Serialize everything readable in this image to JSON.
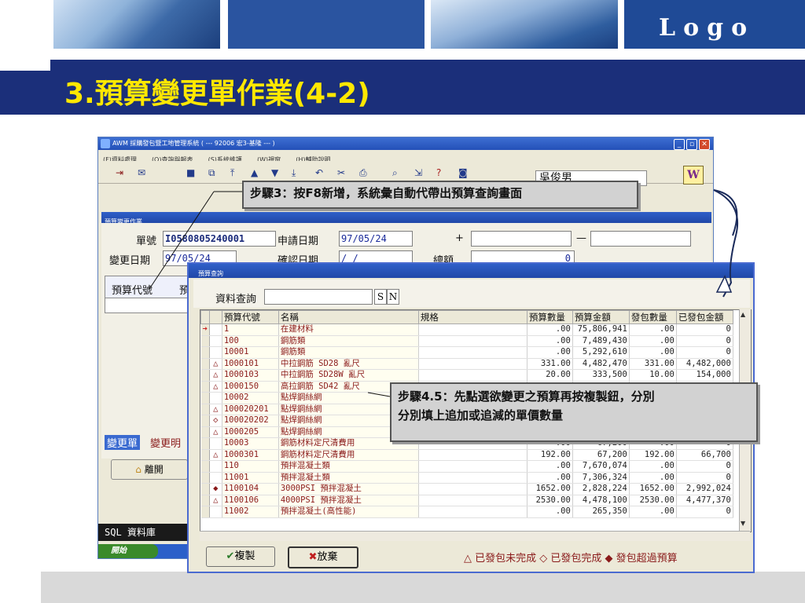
{
  "slide": {
    "logo": "Logo",
    "title": "3.預算變更單作業(4-2)"
  },
  "app": {
    "title": "AWM 採購發包暨工地管理系統 ( --- 92006 宏3-基隆 --- )",
    "menu": [
      "(F)資料處理",
      "(Q)查詢與報表",
      "(S)系統維護",
      "(W)視窗",
      "(H)輔助說明"
    ],
    "user": "吳俊男",
    "w_icon": "W",
    "toolbar_icons": [
      "exit-icon",
      "close-icon",
      "save-icon",
      "copy-icon",
      "first-icon",
      "prev-icon",
      "next-icon",
      "last-icon",
      "undo-icon",
      "cut-icon",
      "print-icon",
      "preview-icon",
      "export-icon",
      "help-icon",
      "camera-icon"
    ]
  },
  "form": {
    "window_title": "預算變更作業",
    "doc_no_label": "單號",
    "doc_no": "I0580805240001",
    "apply_date_label": "申請日期",
    "apply_date": "97/05/24",
    "change_date_label": "變更日期",
    "change_date": "97/05/24",
    "confirm_date_label": "確認日期",
    "confirm_date": "  /  /",
    "total_label": "總額",
    "total_value": "0",
    "plus": "+",
    "minus": "—",
    "grid_header": "預算代號",
    "grid_header2": "預",
    "tab_change": "變更單",
    "tab_detail": "變更明",
    "leave_button": "離開",
    "sql_status": "SQL 資料庫",
    "start_label": "開始"
  },
  "popup": {
    "title": "預算查詢",
    "query_label": "資料查詢",
    "query_value": "",
    "btn_s": "S",
    "btn_n": "N",
    "columns": [
      "預算代號",
      "名稱",
      "規格",
      "預算數量",
      "預算金額",
      "發包數量",
      "已發包金額"
    ],
    "rows": [
      {
        "sel": "➜",
        "mark": "",
        "code": "1",
        "name": "在建材料",
        "spec": "",
        "qty": ".00",
        "amount": "75,806,941",
        "pkg_qty": ".00",
        "pkg_amount": "0"
      },
      {
        "sel": "",
        "mark": "",
        "code": "100",
        "name": "鋼筋類",
        "spec": "",
        "qty": ".00",
        "amount": "7,489,430",
        "pkg_qty": ".00",
        "pkg_amount": "0"
      },
      {
        "sel": "",
        "mark": "",
        "code": "10001",
        "name": "鋼筋類",
        "spec": "",
        "qty": ".00",
        "amount": "5,292,610",
        "pkg_qty": ".00",
        "pkg_amount": "0"
      },
      {
        "sel": "",
        "mark": "△",
        "code": "1000101",
        "name": "中拉鋼筋 SD28 亂尺",
        "spec": "",
        "qty": "331.00",
        "amount": "4,482,470",
        "pkg_qty": "331.00",
        "pkg_amount": "4,482,000"
      },
      {
        "sel": "",
        "mark": "△",
        "code": "1000103",
        "name": "中拉鋼筋 SD28W 亂尺",
        "spec": "",
        "qty": "20.00",
        "amount": "333,500",
        "pkg_qty": "10.00",
        "pkg_amount": "154,000"
      },
      {
        "sel": "",
        "mark": "△",
        "code": "1000150",
        "name": "高拉鋼筋 SD42 亂尺",
        "spec": "",
        "qty": "",
        "amount": "",
        "pkg_qty": "",
        "pkg_amount": ""
      },
      {
        "sel": "",
        "mark": "",
        "code": "10002",
        "name": "點焊鋼絲網",
        "spec": "",
        "qty": "",
        "amount": "",
        "pkg_qty": "",
        "pkg_amount": ""
      },
      {
        "sel": "",
        "mark": "△",
        "code": "100020201",
        "name": "點焊鋼絲網",
        "spec": "",
        "qty": "",
        "amount": "",
        "pkg_qty": "",
        "pkg_amount": ""
      },
      {
        "sel": "",
        "mark": "◇",
        "code": "100020202",
        "name": "點焊鋼絲網",
        "spec": "",
        "qty": "",
        "amount": "",
        "pkg_qty": "",
        "pkg_amount": ""
      },
      {
        "sel": "",
        "mark": "△",
        "code": "1000205",
        "name": "點焊鋼絲網",
        "spec": "",
        "qty": "",
        "amount": "",
        "pkg_qty": "",
        "pkg_amount": ""
      },
      {
        "sel": "",
        "mark": "",
        "code": "10003",
        "name": "鋼筋材料定尺清費用",
        "spec": "",
        "qty": ".00",
        "amount": "67,200",
        "pkg_qty": ".00",
        "pkg_amount": "0"
      },
      {
        "sel": "",
        "mark": "△",
        "code": "1000301",
        "name": "鋼筋材料定尺清費用",
        "spec": "",
        "qty": "192.00",
        "amount": "67,200",
        "pkg_qty": "192.00",
        "pkg_amount": "66,700"
      },
      {
        "sel": "",
        "mark": "",
        "code": "110",
        "name": "預拌混凝土類",
        "spec": "",
        "qty": ".00",
        "amount": "7,670,074",
        "pkg_qty": ".00",
        "pkg_amount": "0"
      },
      {
        "sel": "",
        "mark": "",
        "code": "11001",
        "name": "預拌混凝土類",
        "spec": "",
        "qty": ".00",
        "amount": "7,306,324",
        "pkg_qty": ".00",
        "pkg_amount": "0"
      },
      {
        "sel": "",
        "mark": "◆",
        "code": "1100104",
        "name": "3000PSI 預拌混凝土",
        "spec": "",
        "qty": "1652.00",
        "amount": "2,828,224",
        "pkg_qty": "1652.00",
        "pkg_amount": "2,992,024"
      },
      {
        "sel": "",
        "mark": "△",
        "code": "1100106",
        "name": "4000PSI 預拌混凝土",
        "spec": "",
        "qty": "2530.00",
        "amount": "4,478,100",
        "pkg_qty": "2530.00",
        "pkg_amount": "4,477,370"
      },
      {
        "sel": "",
        "mark": "",
        "code": "11002",
        "name": "預拌混凝土(高性能)",
        "spec": "",
        "qty": ".00",
        "amount": "265,350",
        "pkg_qty": ".00",
        "pkg_amount": "0"
      }
    ],
    "copy_button": "複製",
    "cancel_button": "放棄",
    "legend": "△ 已發包未完成  ◇ 已發包完成  ◆ 發包超過預算"
  },
  "callouts": {
    "step3": "步驟3：按F8新增，系統彙自動代帶出預算查詢畫面",
    "step45_line1": "步驟4.5：先點選欲變更之預算再按複製鈕，分別",
    "step45_line2": "分別填上追加或追減的單價數量"
  },
  "colors": {
    "slide_navy": "#1b2f7a",
    "title_yellow": "#ffe800",
    "window_blue": "#2450b8",
    "grid_text": "#8a1a1a"
  }
}
